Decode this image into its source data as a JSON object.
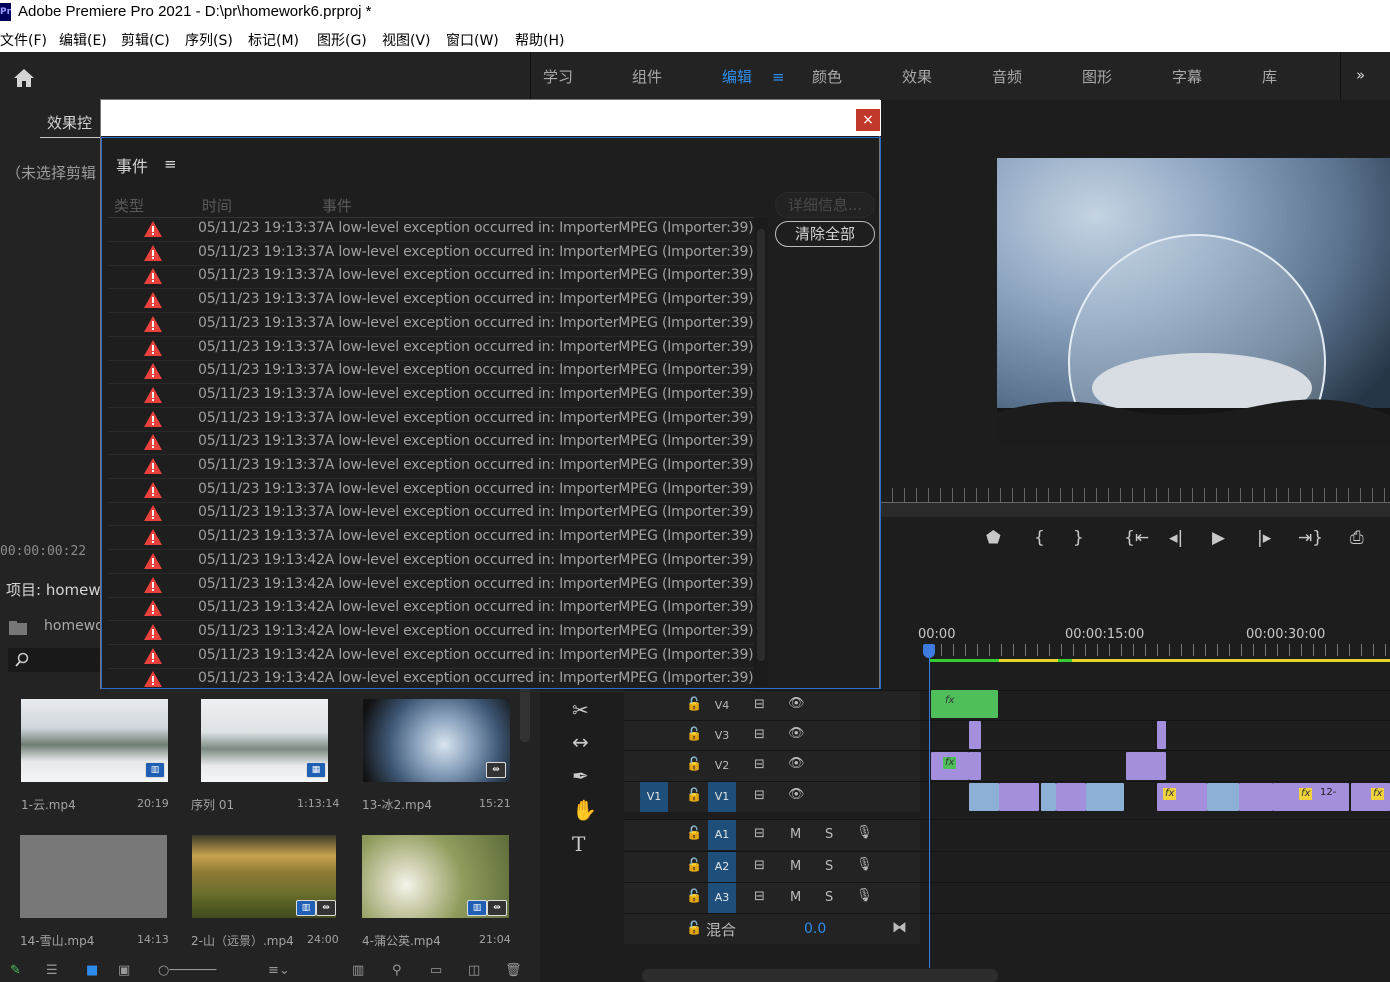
{
  "window": {
    "title": "Adobe Premiere Pro 2021 - D:\\pr\\homework6.prproj *",
    "logo": "Pr"
  },
  "menu": [
    "文件(F)",
    "编辑(E)",
    "剪辑(C)",
    "序列(S)",
    "标记(M)",
    "图形(G)",
    "视图(V)",
    "窗口(W)",
    "帮助(H)"
  ],
  "workspaces": {
    "items": [
      "学习",
      "组件",
      "编辑",
      "颜色",
      "效果",
      "音频",
      "图形",
      "字幕",
      "库"
    ],
    "active": "编辑",
    "overflow": "»"
  },
  "effect_controls": {
    "tab": "效果控",
    "empty_text": "（未选择剪辑",
    "timecode": "00:00:00:22"
  },
  "project": {
    "title": "项目: homewo",
    "file": "homewo",
    "items": [
      {
        "name": "1-云.mp4",
        "duration": "20:19"
      },
      {
        "name": "序列 01",
        "duration": "1:13:14"
      },
      {
        "name": "13-冰2.mp4",
        "duration": "15:21"
      },
      {
        "name": "14-雪山.mp4",
        "duration": "14:13"
      },
      {
        "name": "2-山（远景）.mp4",
        "duration": "24:00"
      },
      {
        "name": "4-蒲公英.mp4",
        "duration": "21:04"
      }
    ]
  },
  "timeline": {
    "ruler": [
      "00:00",
      "00:00:15:00",
      "00:00:30:00"
    ],
    "video_tracks": [
      "V4",
      "V3",
      "V2",
      "V1"
    ],
    "source_patch": "V1",
    "audio_tracks": [
      "A1",
      "A2",
      "A3"
    ],
    "mute": "M",
    "solo": "S",
    "mix_label": "混合",
    "mix_value": "0.0",
    "fx_label": "fx",
    "clip_label": "12-"
  },
  "events_dialog": {
    "title": "事件",
    "menu_icon": "≡",
    "close": "×",
    "columns": [
      "类型",
      "时间",
      "事件"
    ],
    "details_button": "详细信息...",
    "clear_button": "清除全部",
    "rows": [
      "05/11/23 19:13:37A low-level exception occurred in: ImporterMPEG (Importer:39)",
      "05/11/23 19:13:37A low-level exception occurred in: ImporterMPEG (Importer:39)",
      "05/11/23 19:13:37A low-level exception occurred in: ImporterMPEG (Importer:39)",
      "05/11/23 19:13:37A low-level exception occurred in: ImporterMPEG (Importer:39)",
      "05/11/23 19:13:37A low-level exception occurred in: ImporterMPEG (Importer:39)",
      "05/11/23 19:13:37A low-level exception occurred in: ImporterMPEG (Importer:39)",
      "05/11/23 19:13:37A low-level exception occurred in: ImporterMPEG (Importer:39)",
      "05/11/23 19:13:37A low-level exception occurred in: ImporterMPEG (Importer:39)",
      "05/11/23 19:13:37A low-level exception occurred in: ImporterMPEG (Importer:39)",
      "05/11/23 19:13:37A low-level exception occurred in: ImporterMPEG (Importer:39)",
      "05/11/23 19:13:37A low-level exception occurred in: ImporterMPEG (Importer:39)",
      "05/11/23 19:13:37A low-level exception occurred in: ImporterMPEG (Importer:39)",
      "05/11/23 19:13:37A low-level exception occurred in: ImporterMPEG (Importer:39)",
      "05/11/23 19:13:37A low-level exception occurred in: ImporterMPEG (Importer:39)",
      "05/11/23 19:13:42A low-level exception occurred in: ImporterMPEG (Importer:39)",
      "05/11/23 19:13:42A low-level exception occurred in: ImporterMPEG (Importer:39)",
      "05/11/23 19:13:42A low-level exception occurred in: ImporterMPEG (Importer:39)",
      "05/11/23 19:13:42A low-level exception occurred in: ImporterMPEG (Importer:39)",
      "05/11/23 19:13:42A low-level exception occurred in: ImporterMPEG (Importer:39)",
      "05/11/23 19:13:42A low-level exception occurred in: ImporterMPEG (Importer:39)"
    ]
  },
  "colors": {
    "accent": "#2d8ceb",
    "warning": "#e8403a",
    "clip_green": "#4ebf5a",
    "clip_violet": "#a48fdc",
    "clip_blue": "#8db0d6",
    "playhead": "#3d7be0"
  }
}
